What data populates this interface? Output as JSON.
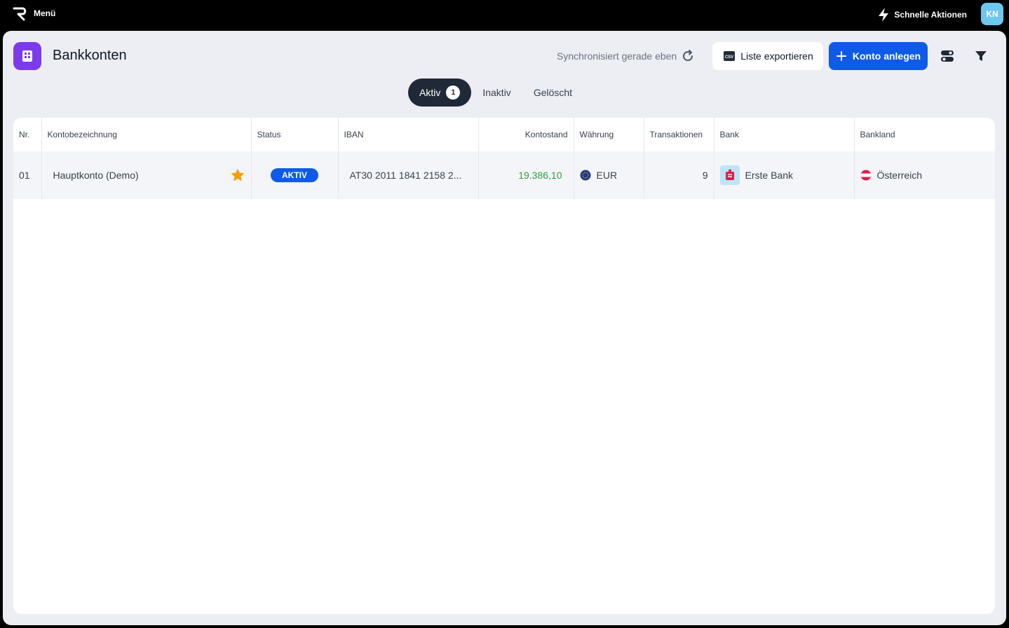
{
  "topbar": {
    "menu_label": "Menü",
    "quick_actions_label": "Schnelle Aktionen",
    "avatar_initials": "KN"
  },
  "header": {
    "title": "Bankkonten",
    "sync_status": "Synchronisiert gerade eben",
    "export_label": "Liste exportieren",
    "create_label": "Konto anlegen"
  },
  "tabs": [
    {
      "label": "Aktiv",
      "count": "1"
    },
    {
      "label": "Inaktiv"
    },
    {
      "label": "Gelöscht"
    }
  ],
  "table": {
    "columns": [
      "Nr.",
      "Kontobezeichnung",
      "Status",
      "IBAN",
      "Kontostand",
      "Währung",
      "Transaktionen",
      "Bank",
      "Bankland"
    ],
    "rows": [
      {
        "nr": "01",
        "name": "Hauptkonto (Demo)",
        "status": "AKTIV",
        "iban": "AT30 2011 1841 2158 2...",
        "balance": "19.386,10",
        "currency": "EUR",
        "transactions": "9",
        "bank": "Erste Bank",
        "country": "Österreich"
      }
    ]
  },
  "colors": {
    "accent": "#0f5be8",
    "page_icon": "#7c3aed",
    "balance_positive": "#2f9e44",
    "star": "#f59e0b"
  }
}
